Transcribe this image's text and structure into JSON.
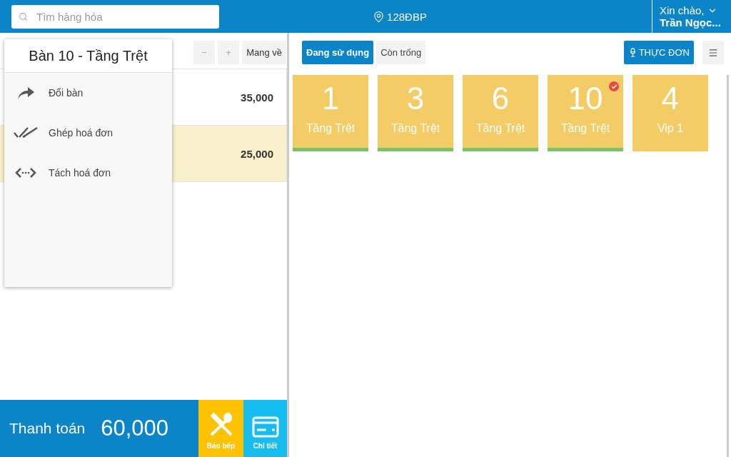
{
  "header": {
    "search": {
      "placeholder": "Tìm hàng hóa"
    },
    "location": "128ĐBP",
    "greeting": "Xin chào,",
    "user": "Trần Ngọc..."
  },
  "order_toolbar": {
    "buttons": [
      "−",
      "+",
      "Mang về"
    ]
  },
  "order_items": [
    {
      "price": "35,000",
      "selected": false
    },
    {
      "price": "25,000",
      "selected": true
    }
  ],
  "context_menu": {
    "title": "Bàn 10 - Tầng Trệt",
    "items": [
      {
        "kind": "move",
        "label": "Đổi bàn"
      },
      {
        "kind": "merge",
        "label": "Ghép hoá đơn"
      },
      {
        "kind": "split",
        "label": "Tách hoá đơn"
      }
    ]
  },
  "footer": {
    "pay_label": "Thanh toán",
    "total": "60,000",
    "kitchen": "Báo bếp",
    "details": "Chi tiết"
  },
  "filter_tabs": [
    {
      "label": "Đang sử dụng",
      "selected": true
    },
    {
      "label": "Còn trống",
      "selected": false
    }
  ],
  "menu_button": "THỰC ĐƠN",
  "tables": [
    {
      "number": "1",
      "area": "Tầng Trệt",
      "in_use": true,
      "checked": false
    },
    {
      "number": "3",
      "area": "Tầng Trệt",
      "in_use": true,
      "checked": false
    },
    {
      "number": "6",
      "area": "Tầng Trệt",
      "in_use": true,
      "checked": false
    },
    {
      "number": "10",
      "area": "Tầng Trệt",
      "in_use": true,
      "checked": true
    },
    {
      "number": "4",
      "area": "Vip 1",
      "in_use": false,
      "checked": false
    }
  ]
}
